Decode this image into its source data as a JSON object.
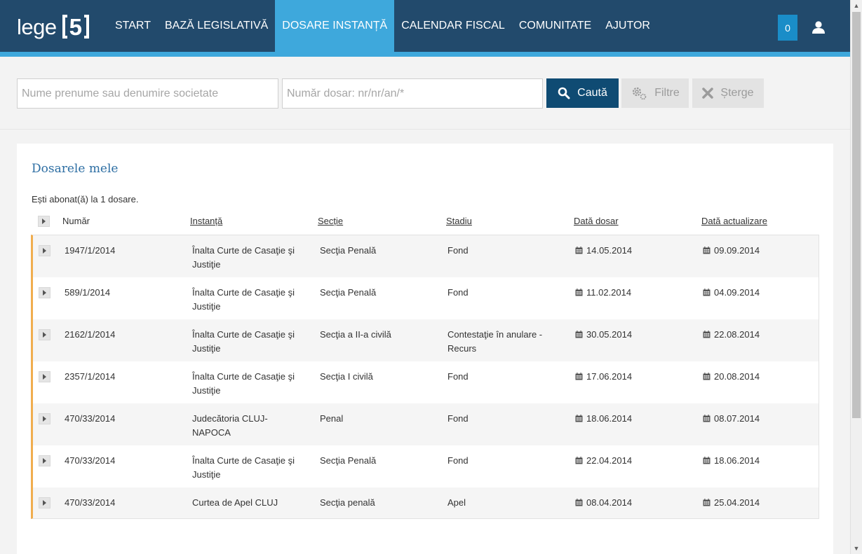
{
  "header": {
    "logo_text": "lege",
    "logo_number": "5",
    "nav": [
      "START",
      "BAZĂ LEGISLATIVĂ",
      "DOSARE INSTANȚĂ",
      "CALENDAR FISCAL",
      "COMUNITATE",
      "AJUTOR"
    ],
    "active_nav": "DOSARE INSTANȚĂ",
    "notification_count": "0",
    "user_icon": "user-icon"
  },
  "search": {
    "name_placeholder": "Nume prenume sau denumire societate",
    "number_placeholder": "Număr dosar: nr/nr/an/*",
    "search_label": "Caută",
    "filter_label": "Filtre",
    "clear_label": "Șterge"
  },
  "panel": {
    "title": "Dosarele mele",
    "subscription_text": "Ești abonat(ă) la 1 dosare."
  },
  "table": {
    "headers": {
      "numar": "Număr",
      "instanta": "Instanță",
      "sectie": "Secție",
      "stadiu": "Stadiu",
      "data_dosar": "Dată dosar",
      "data_actualizare": "Dată actualizare"
    },
    "rows": [
      {
        "numar": "1947/1/2014",
        "instanta": "Înalta Curte de Casaţie şi Justiţie",
        "sectie": "Secţia Penală",
        "stadiu": "Fond",
        "data_dosar": "14.05.2014",
        "data_actualizare": "09.09.2014"
      },
      {
        "numar": "589/1/2014",
        "instanta": "Înalta Curte de Casaţie şi Justiţie",
        "sectie": "Secţia Penală",
        "stadiu": "Fond",
        "data_dosar": "11.02.2014",
        "data_actualizare": "04.09.2014"
      },
      {
        "numar": "2162/1/2014",
        "instanta": "Înalta Curte de Casaţie şi Justiţie",
        "sectie": "Secţia a II-a civilă",
        "stadiu": "Contestaţie în anulare - Recurs",
        "data_dosar": "30.05.2014",
        "data_actualizare": "22.08.2014"
      },
      {
        "numar": "2357/1/2014",
        "instanta": "Înalta Curte de Casaţie şi Justiţie",
        "sectie": "Secţia I civilă",
        "stadiu": "Fond",
        "data_dosar": "17.06.2014",
        "data_actualizare": "20.08.2014"
      },
      {
        "numar": "470/33/2014",
        "instanta": "Judecătoria CLUJ-NAPOCA",
        "sectie": "Penal",
        "stadiu": "Fond",
        "data_dosar": "18.06.2014",
        "data_actualizare": "08.07.2014"
      },
      {
        "numar": "470/33/2014",
        "instanta": "Înalta Curte de Casaţie şi Justiţie",
        "sectie": "Secţia Penală",
        "stadiu": "Fond",
        "data_dosar": "22.04.2014",
        "data_actualizare": "18.06.2014"
      },
      {
        "numar": "470/33/2014",
        "instanta": "Curtea de Apel CLUJ",
        "sectie": "Secţia penală",
        "stadiu": "Apel",
        "data_dosar": "08.04.2014",
        "data_actualizare": "25.04.2014"
      }
    ]
  },
  "colors": {
    "header_bg": "#224a6c",
    "accent": "#3ea8dc",
    "search_button": "#0f4b73",
    "row_marker": "#f0ad4e",
    "title": "#2d6ea3"
  }
}
